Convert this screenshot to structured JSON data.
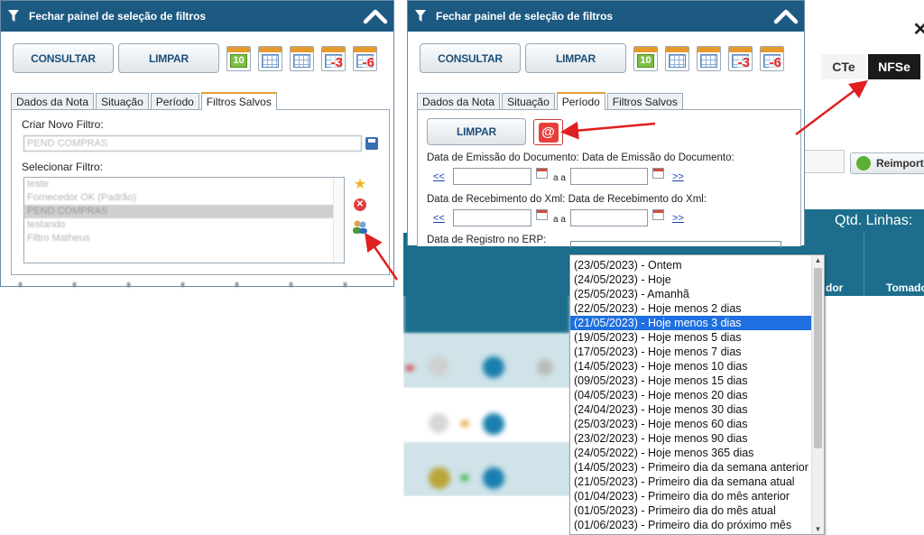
{
  "left_panel": {
    "header_title": "Fechar painel de seleção de filtros",
    "buttons": {
      "consultar": "CONSULTAR",
      "limpar": "LIMPAR"
    },
    "calendar_icons": [
      {
        "name": "calendar-today-icon",
        "label": "10"
      },
      {
        "name": "calendar-week-icon",
        "label": ""
      },
      {
        "name": "calendar-month-icon",
        "label": ""
      },
      {
        "name": "calendar-minus-3-icon",
        "label": "-3"
      },
      {
        "name": "calendar-minus-6-icon",
        "label": "-6"
      }
    ],
    "tabs": [
      "Dados da Nota",
      "Situação",
      "Período",
      "Filtros Salvos"
    ],
    "active_tab": "Filtros Salvos",
    "criar_label": "Criar Novo Filtro:",
    "criar_value": "PEND COMPRAS",
    "selecionar_label": "Selecionar Filtro:",
    "filters": [
      "teste",
      "Fornecedor OK (Padrão)",
      "PEND COMPRAS",
      "testando",
      "Filtro Matheus"
    ],
    "selected_filter": "PEND COMPRAS"
  },
  "right_panel": {
    "header_title": "Fechar painel de seleção de filtros",
    "buttons": {
      "consultar": "CONSULTAR",
      "limpar": "LIMPAR",
      "limpar_periodo": "LIMPAR"
    },
    "at_button": "@",
    "tabs": [
      "Dados da Nota",
      "Situação",
      "Período",
      "Filtros Salvos"
    ],
    "active_tab": "Período",
    "emissao_label": "Data de Emissão do Documento: Data de Emissão do Documento:",
    "recebimento_label": "Data de Recebimento do Xml: Data de Recebimento do Xml:",
    "registro_label": "Data de Registro no ERP:",
    "prev_link": "<<",
    "next_link": ">>",
    "a_a": "a a"
  },
  "background": {
    "tab_cte": "CTe",
    "tab_nfse": "NFSe",
    "reimport": "Reimporta",
    "qtd_linhas": "Qtd. Linhas:",
    "col_dor": "dor",
    "col_tomado": "Tomado"
  },
  "period_dropdown": {
    "options": [
      "(23/05/2023) - Ontem",
      "(24/05/2023) - Hoje",
      "(25/05/2023) - Amanhã",
      "(22/05/2023) - Hoje menos 2 dias",
      "(21/05/2023) - Hoje menos 3 dias",
      "(19/05/2023) - Hoje menos 5 dias",
      "(17/05/2023) - Hoje menos 7 dias",
      "(14/05/2023) - Hoje menos 10 dias",
      "(09/05/2023) - Hoje menos 15 dias",
      "(04/05/2023) - Hoje menos 20 dias",
      "(24/04/2023) - Hoje menos 30 dias",
      "(25/03/2023) - Hoje menos 60 dias",
      "(23/02/2023) - Hoje menos 90 dias",
      "(24/05/2022) - Hoje menos 365 dias",
      "(14/05/2023) - Primeiro dia da semana anterior",
      "(21/05/2023) - Primeiro dia da semana atual",
      "(01/04/2023) - Primeiro dia do mês anterior",
      "(01/05/2023) - Primeiro dia do mês atual",
      "(01/06/2023) - Primeiro dia do próximo mês"
    ],
    "selected_index": 4
  },
  "colors": {
    "header_blue": "#1d5a82",
    "button_text": "#1d4f79",
    "teal": "#1c6e8c",
    "selection_blue": "#1e6fe0",
    "arrow_red": "#e02020",
    "tab_active_accent": "#e2a234"
  }
}
